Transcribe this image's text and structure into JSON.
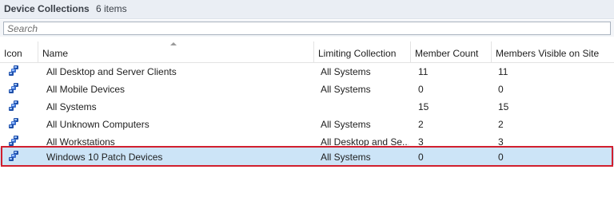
{
  "window": {
    "title": "Device Collections",
    "count": "6 items"
  },
  "search": {
    "placeholder": "Search"
  },
  "columns": {
    "icon": "Icon",
    "name": "Name",
    "limiting": "Limiting Collection",
    "member_count": "Member Count",
    "visible": "Members Visible on Site"
  },
  "rows": [
    {
      "icon": "device-collection-icon",
      "name": "All Desktop and Server Clients",
      "limiting": "All Systems",
      "member_count": "11",
      "visible": "11"
    },
    {
      "icon": "device-collection-icon",
      "name": "All Mobile Devices",
      "limiting": "All Systems",
      "member_count": "0",
      "visible": "0"
    },
    {
      "icon": "device-collection-icon",
      "name": "All Systems",
      "limiting": "",
      "member_count": "15",
      "visible": "15"
    },
    {
      "icon": "device-collection-icon",
      "name": "All Unknown Computers",
      "limiting": "All Systems",
      "member_count": "2",
      "visible": "2"
    },
    {
      "icon": "device-collection-icon",
      "name": "All Workstations",
      "limiting": "All Desktop and Se...",
      "member_count": "3",
      "visible": "3"
    },
    {
      "icon": "device-collection-icon",
      "name": "Windows 10 Patch Devices",
      "limiting": "All Systems",
      "member_count": "0",
      "visible": "0",
      "selected": true
    }
  ],
  "colors": {
    "selection": "#cce4f7",
    "highlight_border": "#d11f2e",
    "header_bar": "#eaeef4"
  }
}
